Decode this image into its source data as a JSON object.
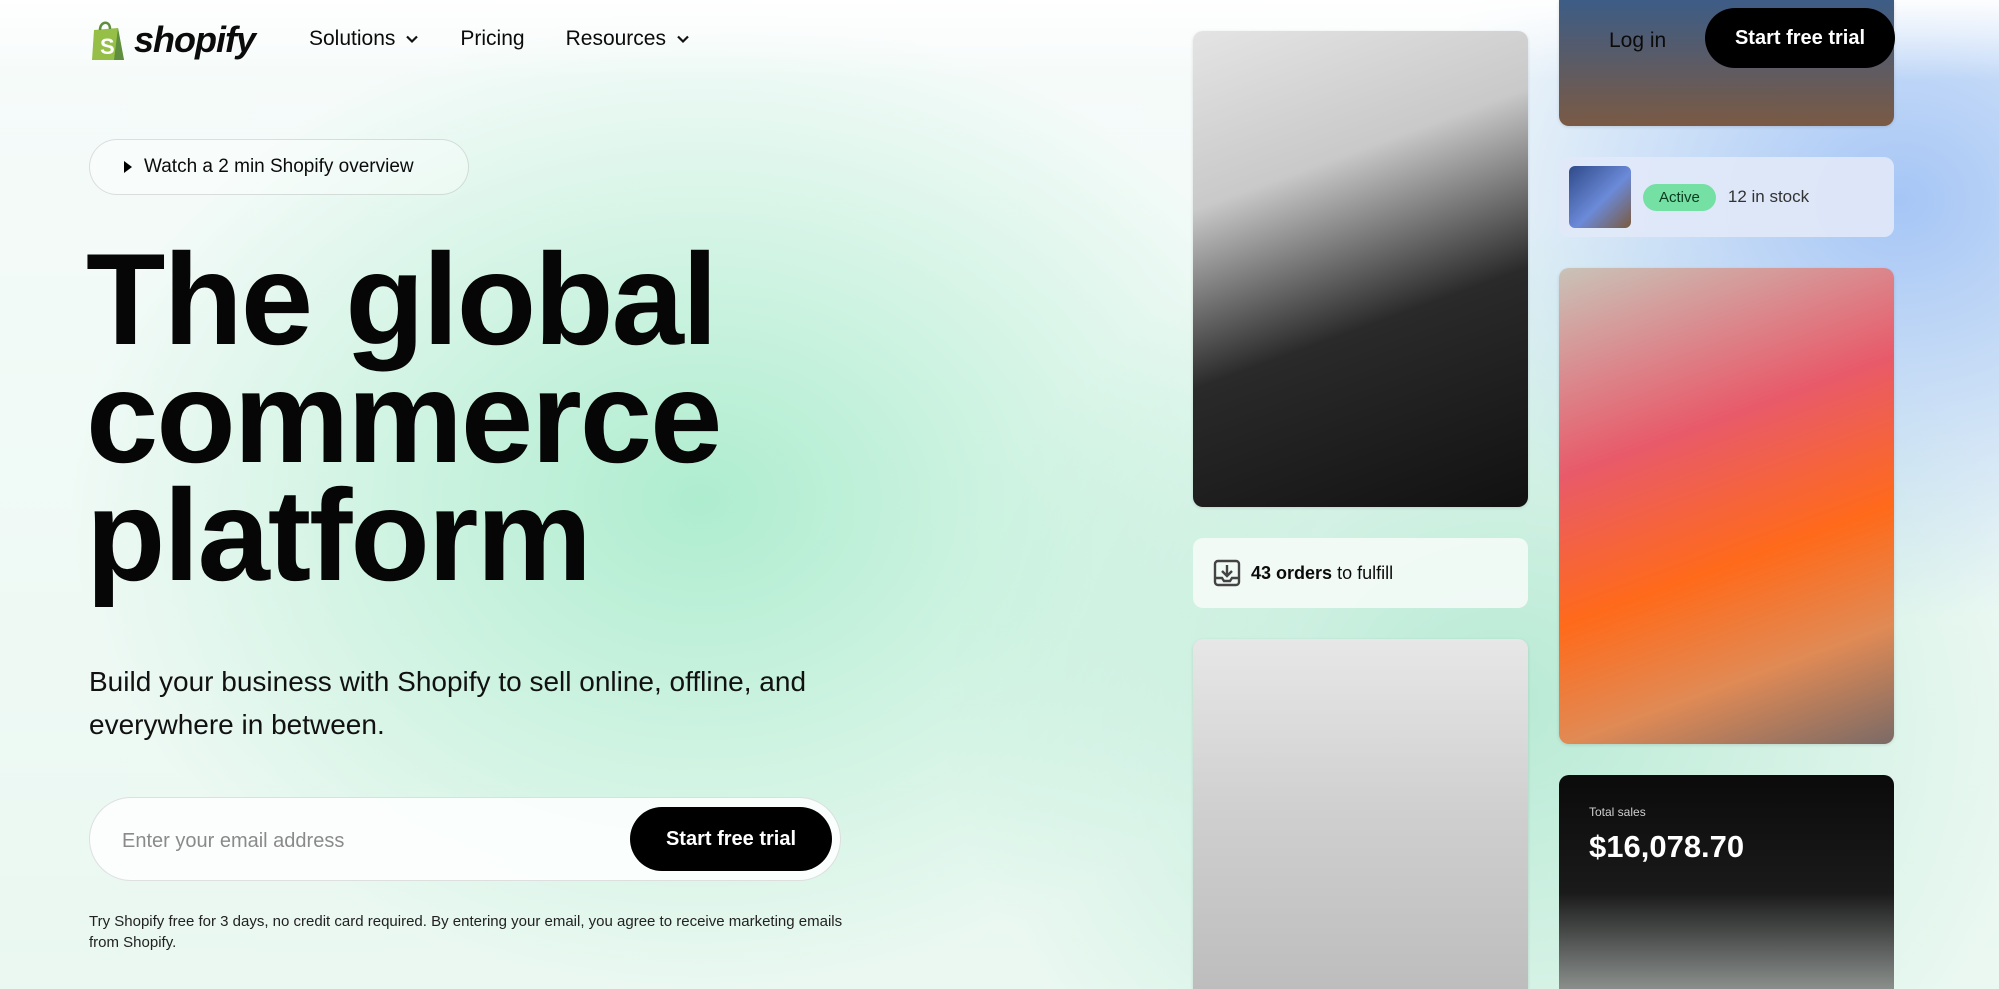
{
  "header": {
    "logo_text": "shopify",
    "nav": [
      {
        "label": "Solutions",
        "has_dropdown": true
      },
      {
        "label": "Pricing",
        "has_dropdown": false
      },
      {
        "label": "Resources",
        "has_dropdown": true
      }
    ],
    "login_label": "Log in",
    "cta_label": "Start free trial"
  },
  "hero": {
    "watch_label": "Watch a 2 min Shopify overview",
    "headline_lines": [
      "The global",
      "commerce",
      "platform"
    ],
    "subheadline": "Build your business with Shopify to sell online, offline, and everywhere in between.",
    "email_placeholder": "Enter your email address",
    "email_cta_label": "Start free trial",
    "disclaimer": "Try Shopify free for 3 days, no credit card required. By entering your email, you agree to receive marketing emails from Shopify."
  },
  "collage": {
    "stock_card": {
      "status": "Active",
      "stock_text": "12 in stock"
    },
    "orders_card": {
      "count_text": "43 orders",
      "suffix_text": "to fulfill"
    },
    "sales_card": {
      "label": "Total sales",
      "value": "$16,078.70"
    }
  },
  "colors": {
    "brand_green": "#95bf47",
    "badge_green": "#74e0a4",
    "cta_black": "#000000"
  },
  "icons": [
    "shopify-bag-icon",
    "chevron-down-icon",
    "play-icon",
    "inbox-download-icon"
  ]
}
